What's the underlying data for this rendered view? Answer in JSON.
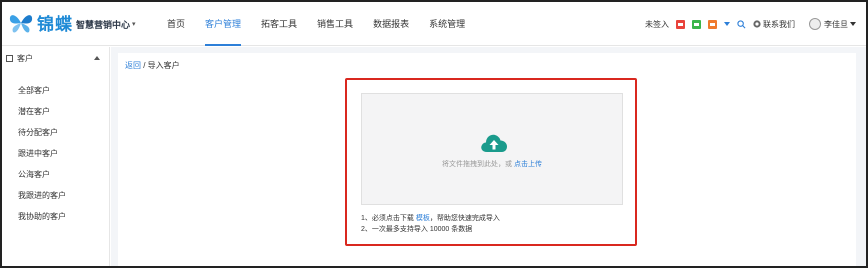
{
  "brand": {
    "name": "锦蝶",
    "subtitle": "智慧营销中心",
    "caret": "▾"
  },
  "nav": {
    "items": [
      {
        "label": "首页"
      },
      {
        "label": "客户管理"
      },
      {
        "label": "拓客工具"
      },
      {
        "label": "销售工具"
      },
      {
        "label": "数据报表"
      },
      {
        "label": "系统管理"
      }
    ],
    "active_index": 1
  },
  "topbar": {
    "signin_status": "未签入",
    "contact_label": "联系我们",
    "user_name": "李佳旦"
  },
  "sidebar": {
    "section_title": "客户",
    "items": [
      {
        "label": "全部客户"
      },
      {
        "label": "潜在客户"
      },
      {
        "label": "待分配客户"
      },
      {
        "label": "跟进中客户"
      },
      {
        "label": "公海客户"
      },
      {
        "label": "我跟进的客户"
      },
      {
        "label": "我协助的客户"
      }
    ]
  },
  "breadcrumb": {
    "back": "返回",
    "separator": " / ",
    "current": "导入客户"
  },
  "upload": {
    "hint_prefix": "将文件拖拽到此处，或 ",
    "hint_link": "点击上传",
    "tip1_prefix": "1、必须点击下载 ",
    "tip1_link": "模板",
    "tip1_suffix": "，帮助您快速完成导入",
    "tip2": "2、一次最多支持导入 10000 条数据"
  },
  "colors": {
    "accent": "#2d7fd8",
    "highlight_border": "#d9281f",
    "upload_icon": "#1a9b8c"
  }
}
